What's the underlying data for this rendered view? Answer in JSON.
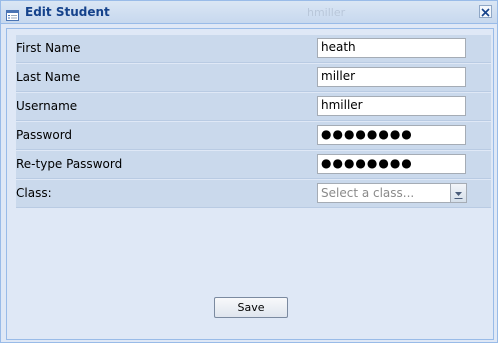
{
  "window": {
    "title": "Edit Student",
    "subtitle": "hmiller"
  },
  "form": {
    "rows": [
      {
        "label": "First Name",
        "value": "heath"
      },
      {
        "label": "Last Name",
        "value": "miller"
      },
      {
        "label": "Username",
        "value": "hmiller"
      },
      {
        "label": "Password",
        "value": "●●●●●●●●"
      },
      {
        "label": "Re-type Password",
        "value": "●●●●●●●●"
      }
    ],
    "class": {
      "label": "Class:",
      "placeholder": "Select a class..."
    }
  },
  "buttons": {
    "save": "Save"
  },
  "icons": {
    "window": "form-window-icon",
    "close": "close-icon",
    "trigger": "dropdown-trigger-icon"
  }
}
